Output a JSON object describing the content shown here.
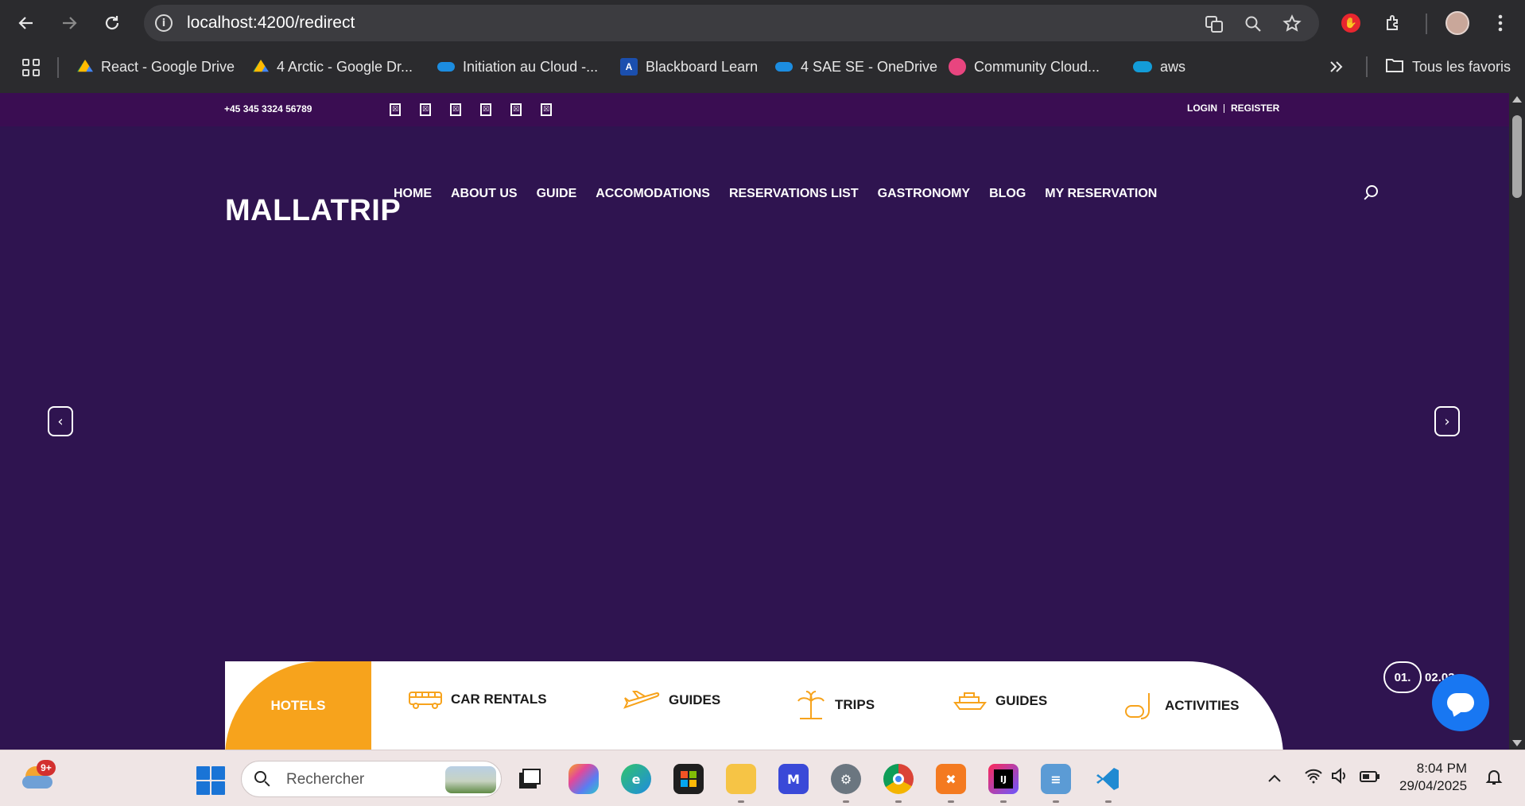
{
  "browser": {
    "url_host": "localhost",
    "url_path": ":4200/redirect",
    "bookmarks": [
      {
        "label": "React - Google Drive",
        "icon": "google-drive-icon"
      },
      {
        "label": "4 Arctic - Google Dr...",
        "icon": "google-drive-icon"
      },
      {
        "label": "Initiation au Cloud -...",
        "icon": "onedrive-icon"
      },
      {
        "label": "Blackboard Learn",
        "icon": "blackboard-icon"
      },
      {
        "label": "4 SAE SE - OneDrive",
        "icon": "onedrive-icon"
      },
      {
        "label": "Community Cloud...",
        "icon": "community-cloud-icon"
      },
      {
        "label": "aws",
        "icon": "salesforce-cloud-icon"
      }
    ],
    "all_bookmarks_label": "Tous les favoris"
  },
  "site": {
    "phone": "+45 345 3324 56789",
    "social_icons": [
      "facebook-icon",
      "twitter-icon",
      "instagram-icon",
      "linkedin-icon",
      "pinterest-icon",
      "youtube-icon"
    ],
    "social_glyph": "☒",
    "login": "LOGIN",
    "register": "REGISTER",
    "logo": "MALLATRIP",
    "nav": [
      "HOME",
      "ABOUT US",
      "GUIDE",
      "ACCOMODATIONS",
      "RESERVATIONS LIST",
      "GASTRONOMY",
      "BLOG",
      "MY RESERVATION"
    ],
    "slider": {
      "prev_glyph": "‹",
      "next_glyph": "›",
      "current": "01.",
      "total": "02.03"
    },
    "tabs": {
      "active": "HOTELS",
      "items": [
        "CAR RENTALS",
        "GUIDES",
        "TRIPS",
        "GUIDES",
        "ACTIVITIES"
      ]
    },
    "accent_color": "#f7a31c",
    "background_color": "#2f1450",
    "topbar_color": "#3a0d52",
    "chat_color": "#1877f2"
  },
  "taskbar": {
    "notification_badge": "9+",
    "search_placeholder": "Rechercher",
    "time": "8:04 PM",
    "date": "29/04/2025"
  }
}
